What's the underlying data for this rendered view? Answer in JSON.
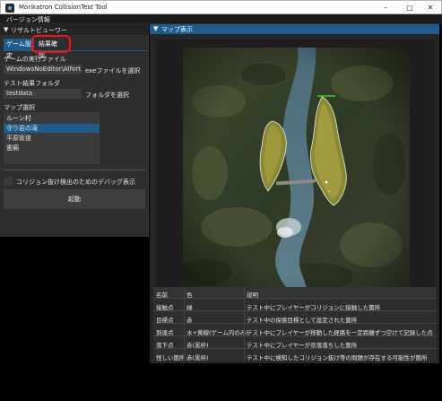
{
  "window": {
    "title": "Morikatron CollisionTest Tool",
    "minimize_glyph": "–",
    "maximize_glyph": "□",
    "close_glyph": "✕"
  },
  "menu": {
    "items": [
      "バージョン情報"
    ]
  },
  "left_panel": {
    "header_arrow": "▼",
    "header": "リザルトビューワー",
    "tabs": [
      "ゲーム設定",
      "結果確認"
    ],
    "active_tab": "ゲーム設定",
    "exe_label": "ゲームの実行ファイル",
    "exe_value": "WindowsNoEditor\\Alfort.ex",
    "exe_button": "exeファイルを選択",
    "folder_label": "テスト結果フォルダ",
    "folder_value": "testdata",
    "folder_button": "フォルダを選択",
    "map_label": "マップ選択",
    "maps": [
      "ルーン村",
      "守り岩の滝",
      "平原街道",
      "霊廟"
    ],
    "selected_map": "守り岩の滝",
    "debug_checkbox_label": "コリジョン抜け検出のためのデバッグ表示",
    "debug_checked": false,
    "launch_button": "起動"
  },
  "map_panel": {
    "header_arrow": "▼",
    "header": "マップ表示"
  },
  "legend": {
    "headers": [
      "名前",
      "色",
      "説明"
    ],
    "rows": [
      [
        "接触点",
        "緑",
        "テスト中にプレイヤーがコリジョンに接触した箇所"
      ],
      [
        "目標点",
        "赤",
        "テスト中の探索目標として設定された箇所"
      ],
      [
        "到達点",
        "水+黄線(ゲーム内のみ)",
        "テスト中にプレイヤーが移動した経路を一定距離ずつ空けて記録した点"
      ],
      [
        "落下点",
        "赤(黒枠)",
        "テスト中にプレイヤーが奈落落ちした箇所"
      ],
      [
        "怪しい箇所",
        "赤(黒枠)",
        "テスト中に検知したコリジョン抜け等の問題が存在する可能性が箇所"
      ]
    ]
  },
  "colors": {
    "accent": "#1e5c8c",
    "annotation": "#ff1010",
    "contact_line": "#22dd33"
  }
}
